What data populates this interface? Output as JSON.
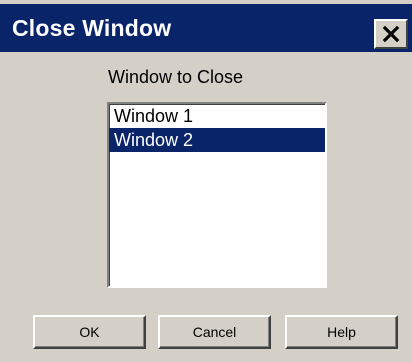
{
  "window": {
    "title": "Close Window"
  },
  "dialog": {
    "label": "Window to Close",
    "list": {
      "items": [
        {
          "label": "Window 1",
          "selected": false
        },
        {
          "label": "Window 2",
          "selected": true
        }
      ]
    },
    "buttons": {
      "ok": "OK",
      "cancel": "Cancel",
      "help": "Help"
    }
  },
  "colors": {
    "titlebar": "#0a246a",
    "face": "#d4d0c8",
    "selection": "#0a246a"
  },
  "icons": {
    "close": "close-icon"
  }
}
